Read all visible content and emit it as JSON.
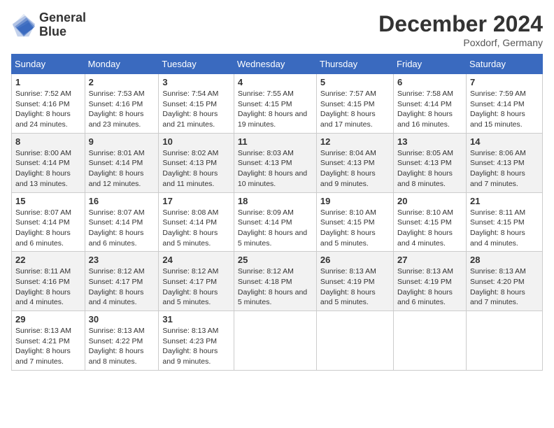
{
  "header": {
    "logo_line1": "General",
    "logo_line2": "Blue",
    "month_title": "December 2024",
    "location": "Poxdorf, Germany"
  },
  "weekdays": [
    "Sunday",
    "Monday",
    "Tuesday",
    "Wednesday",
    "Thursday",
    "Friday",
    "Saturday"
  ],
  "weeks": [
    [
      {
        "day": "1",
        "sunrise": "7:52 AM",
        "sunset": "4:16 PM",
        "daylight": "8 hours and 24 minutes."
      },
      {
        "day": "2",
        "sunrise": "7:53 AM",
        "sunset": "4:16 PM",
        "daylight": "8 hours and 23 minutes."
      },
      {
        "day": "3",
        "sunrise": "7:54 AM",
        "sunset": "4:15 PM",
        "daylight": "8 hours and 21 minutes."
      },
      {
        "day": "4",
        "sunrise": "7:55 AM",
        "sunset": "4:15 PM",
        "daylight": "8 hours and 19 minutes."
      },
      {
        "day": "5",
        "sunrise": "7:57 AM",
        "sunset": "4:15 PM",
        "daylight": "8 hours and 17 minutes."
      },
      {
        "day": "6",
        "sunrise": "7:58 AM",
        "sunset": "4:14 PM",
        "daylight": "8 hours and 16 minutes."
      },
      {
        "day": "7",
        "sunrise": "7:59 AM",
        "sunset": "4:14 PM",
        "daylight": "8 hours and 15 minutes."
      }
    ],
    [
      {
        "day": "8",
        "sunrise": "8:00 AM",
        "sunset": "4:14 PM",
        "daylight": "8 hours and 13 minutes."
      },
      {
        "day": "9",
        "sunrise": "8:01 AM",
        "sunset": "4:14 PM",
        "daylight": "8 hours and 12 minutes."
      },
      {
        "day": "10",
        "sunrise": "8:02 AM",
        "sunset": "4:13 PM",
        "daylight": "8 hours and 11 minutes."
      },
      {
        "day": "11",
        "sunrise": "8:03 AM",
        "sunset": "4:13 PM",
        "daylight": "8 hours and 10 minutes."
      },
      {
        "day": "12",
        "sunrise": "8:04 AM",
        "sunset": "4:13 PM",
        "daylight": "8 hours and 9 minutes."
      },
      {
        "day": "13",
        "sunrise": "8:05 AM",
        "sunset": "4:13 PM",
        "daylight": "8 hours and 8 minutes."
      },
      {
        "day": "14",
        "sunrise": "8:06 AM",
        "sunset": "4:13 PM",
        "daylight": "8 hours and 7 minutes."
      }
    ],
    [
      {
        "day": "15",
        "sunrise": "8:07 AM",
        "sunset": "4:14 PM",
        "daylight": "8 hours and 6 minutes."
      },
      {
        "day": "16",
        "sunrise": "8:07 AM",
        "sunset": "4:14 PM",
        "daylight": "8 hours and 6 minutes."
      },
      {
        "day": "17",
        "sunrise": "8:08 AM",
        "sunset": "4:14 PM",
        "daylight": "8 hours and 5 minutes."
      },
      {
        "day": "18",
        "sunrise": "8:09 AM",
        "sunset": "4:14 PM",
        "daylight": "8 hours and 5 minutes."
      },
      {
        "day": "19",
        "sunrise": "8:10 AM",
        "sunset": "4:15 PM",
        "daylight": "8 hours and 5 minutes."
      },
      {
        "day": "20",
        "sunrise": "8:10 AM",
        "sunset": "4:15 PM",
        "daylight": "8 hours and 4 minutes."
      },
      {
        "day": "21",
        "sunrise": "8:11 AM",
        "sunset": "4:15 PM",
        "daylight": "8 hours and 4 minutes."
      }
    ],
    [
      {
        "day": "22",
        "sunrise": "8:11 AM",
        "sunset": "4:16 PM",
        "daylight": "8 hours and 4 minutes."
      },
      {
        "day": "23",
        "sunrise": "8:12 AM",
        "sunset": "4:17 PM",
        "daylight": "8 hours and 4 minutes."
      },
      {
        "day": "24",
        "sunrise": "8:12 AM",
        "sunset": "4:17 PM",
        "daylight": "8 hours and 5 minutes."
      },
      {
        "day": "25",
        "sunrise": "8:12 AM",
        "sunset": "4:18 PM",
        "daylight": "8 hours and 5 minutes."
      },
      {
        "day": "26",
        "sunrise": "8:13 AM",
        "sunset": "4:19 PM",
        "daylight": "8 hours and 5 minutes."
      },
      {
        "day": "27",
        "sunrise": "8:13 AM",
        "sunset": "4:19 PM",
        "daylight": "8 hours and 6 minutes."
      },
      {
        "day": "28",
        "sunrise": "8:13 AM",
        "sunset": "4:20 PM",
        "daylight": "8 hours and 7 minutes."
      }
    ],
    [
      {
        "day": "29",
        "sunrise": "8:13 AM",
        "sunset": "4:21 PM",
        "daylight": "8 hours and 7 minutes."
      },
      {
        "day": "30",
        "sunrise": "8:13 AM",
        "sunset": "4:22 PM",
        "daylight": "8 hours and 8 minutes."
      },
      {
        "day": "31",
        "sunrise": "8:13 AM",
        "sunset": "4:23 PM",
        "daylight": "8 hours and 9 minutes."
      },
      null,
      null,
      null,
      null
    ]
  ]
}
